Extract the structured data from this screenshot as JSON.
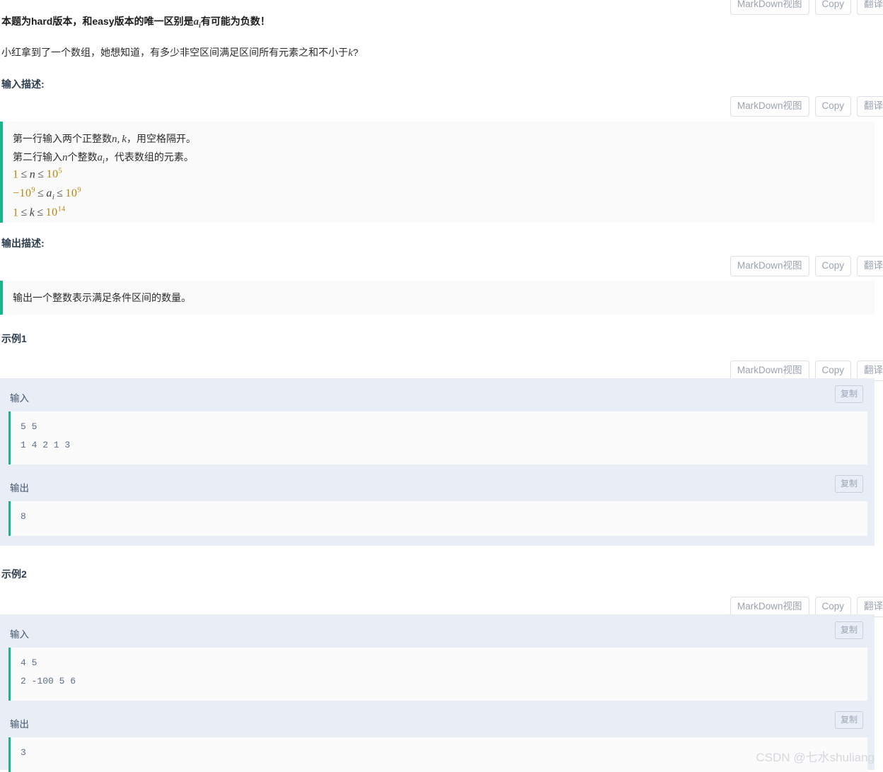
{
  "toolbars": {
    "markdown_label": "MarkDown视图",
    "copy_label": "Copy",
    "translate_label": "翻译"
  },
  "problem": {
    "intro_bold_pre": "本题为hard版本，和easy版本的唯一区别是",
    "intro_bold_var": "a",
    "intro_bold_var_sub": "i",
    "intro_bold_post": "有可能为负数！",
    "statement_pre": "小红拿到了一个数组，她想知道，有多少非空区间满足区间所有元素之和不小于",
    "statement_var": "k",
    "statement_post": "?"
  },
  "input_section": {
    "title": "输入描述:",
    "lines": [
      "第一行输入两个正整数",
      "第二行输入"
    ],
    "line1_var_n": "n",
    "line1_var_comma": ",",
    "line1_var_k": "k",
    "line1_tail": "，用空格隔开。",
    "line2_var_n": "n",
    "line2_mid": "个整数",
    "line2_var_a": "a",
    "line2_var_a_sub": "i",
    "line2_tail": "，代表数组的元素。",
    "constraints": [
      {
        "lo": "1",
        "rel1": "≤",
        "var": "n",
        "var_sub": "",
        "rel2": "≤",
        "hi_base": "10",
        "hi_exp": "5",
        "lo_neg": false,
        "lo_exp": ""
      },
      {
        "lo": "10",
        "rel1": "≤",
        "var": "a",
        "var_sub": "i",
        "rel2": "≤",
        "hi_base": "10",
        "hi_exp": "9",
        "lo_neg": true,
        "lo_exp": "9"
      },
      {
        "lo": "1",
        "rel1": "≤",
        "var": "k",
        "var_sub": "",
        "rel2": "≤",
        "hi_base": "10",
        "hi_exp": "14",
        "lo_neg": false,
        "lo_exp": ""
      }
    ]
  },
  "output_section": {
    "title": "输出描述:",
    "text": "输出一个整数表示满足条件区间的数量。"
  },
  "examples": [
    {
      "title": "示例1",
      "input_label": "输入",
      "output_label": "输出",
      "copy_label": "复制",
      "input_lines": [
        "5 5",
        "1 4 2 1 3"
      ],
      "output_lines": [
        "8"
      ]
    },
    {
      "title": "示例2",
      "input_label": "输入",
      "output_label": "输出",
      "copy_label": "复制",
      "input_lines": [
        "4 5",
        "2 -100 5 6"
      ],
      "output_lines": [
        "3"
      ]
    }
  ],
  "watermark": {
    "text": "CSDN @七水shuliang"
  },
  "colors": {
    "accent_teal": "#19b487",
    "sample_bg": "#e9eef6",
    "desc_bg": "#fafafa",
    "heading": "#2c3e50",
    "math_number": "#b8860b"
  }
}
